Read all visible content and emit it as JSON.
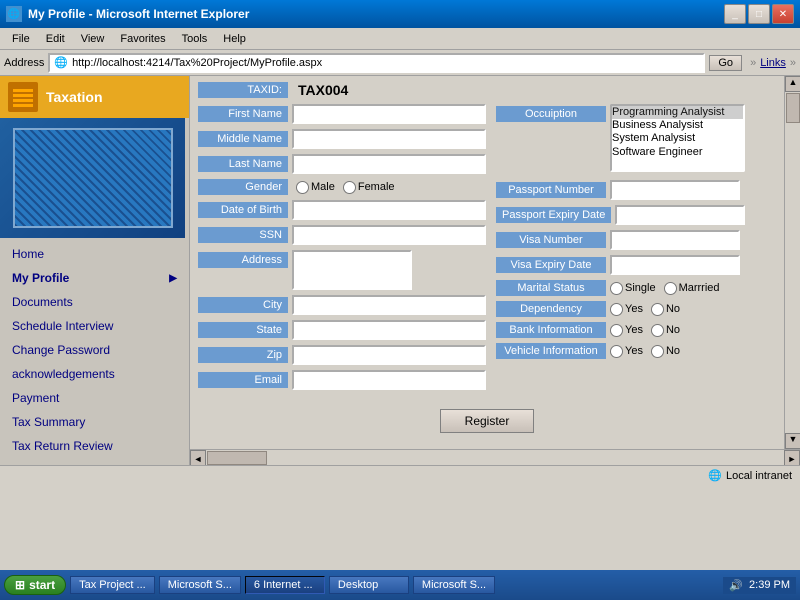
{
  "window": {
    "title": "My Profile - Microsoft Internet Explorer",
    "icon": "ie-icon"
  },
  "menubar": {
    "items": [
      "File",
      "Edit",
      "View",
      "Favorites",
      "Tools",
      "Help"
    ]
  },
  "addressbar": {
    "label": "Address",
    "url": "http://localhost:4214/Tax%20Project/MyProfile.aspx",
    "go_label": "Go",
    "links_label": "Links"
  },
  "sidebar": {
    "header_label": "Taxation",
    "nav_items": [
      {
        "label": "Home",
        "has_arrow": false
      },
      {
        "label": "My Profile",
        "has_arrow": true,
        "active": true
      },
      {
        "label": "Documents",
        "has_arrow": false
      },
      {
        "label": "Schedule Interview",
        "has_arrow": false
      },
      {
        "label": "Change Password",
        "has_arrow": false
      },
      {
        "label": "acknowledgements",
        "has_arrow": false
      },
      {
        "label": "Payment",
        "has_arrow": false
      },
      {
        "label": "Tax Summary",
        "has_arrow": false
      },
      {
        "label": "Tax Return Review",
        "has_arrow": false
      }
    ]
  },
  "form": {
    "taxid_label": "TAXID:",
    "taxid_value": "TAX004",
    "first_name_label": "First Name",
    "middle_name_label": "Middle Name",
    "last_name_label": "Last Name",
    "gender_label": "Gender",
    "gender_options": [
      "Male",
      "Female"
    ],
    "dob_label": "Date of Birth",
    "ssn_label": "SSN",
    "address_label": "Address",
    "city_label": "City",
    "state_label": "State",
    "zip_label": "Zip",
    "email_label": "Email",
    "occupation_label": "Occuiption",
    "occupation_options": [
      {
        "label": "Programming Analysist",
        "selected": true
      },
      {
        "label": "Business Analysist",
        "selected": false
      },
      {
        "label": "System Analysist",
        "selected": false
      },
      {
        "label": "Software Engineer",
        "selected": false
      }
    ],
    "passport_number_label": "Passport Number",
    "passport_expiry_label": "Passport Expiry Date",
    "visa_number_label": "Visa Number",
    "visa_expiry_label": "Visa Expiry Date",
    "marital_status_label": "Marital Status",
    "marital_options": [
      "Single",
      "Marrried"
    ],
    "dependency_label": "Dependency",
    "yn_options": [
      "Yes",
      "No"
    ],
    "bank_info_label": "Bank Information",
    "vehicle_info_label": "Vehicle Information",
    "register_label": "Register"
  },
  "statusbar": {
    "status": "Local intranet"
  },
  "taskbar": {
    "start_label": "start",
    "tasks": [
      {
        "label": "Tax Project ...",
        "active": false
      },
      {
        "label": "Microsoft S...",
        "active": false
      },
      {
        "label": "6 Internet ...",
        "active": true
      },
      {
        "label": "Desktop",
        "active": false
      },
      {
        "label": "Microsoft S...",
        "active": false
      }
    ],
    "time": "2:39 PM"
  },
  "window_controls": {
    "minimize": "_",
    "maximize": "□",
    "close": "✕"
  }
}
